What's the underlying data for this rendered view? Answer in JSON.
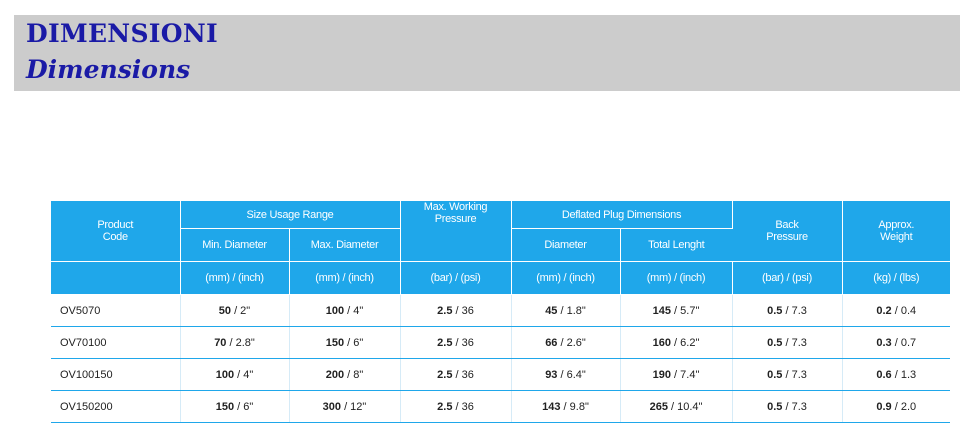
{
  "title": {
    "it": "DIMENSIONI",
    "en": "Dimensions"
  },
  "table": {
    "headers": {
      "product_code": "Product\nCode",
      "size_usage_range": "Size Usage Range",
      "min_diameter": "Min. Diameter",
      "max_diameter": "Max. Diameter",
      "max_working_pressure": "Max. Working\nPressure",
      "deflated_plug_dimensions": "Deflated Plug Dimensions",
      "diameter": "Diameter",
      "total_length": "Total Lenght",
      "back_pressure": "Back\nPressure",
      "approx_weight": "Approx.\nWeight"
    },
    "units": {
      "min_diameter": "(mm) / (inch)",
      "max_diameter": "(mm) / (inch)",
      "pressure": "(bar) / (psi)",
      "diameter": "(mm) / (inch)",
      "total_length": "(mm) / (inch)",
      "back_pressure": "(bar) / (psi)",
      "weight": "(kg) / (lbs)"
    },
    "rows": [
      {
        "code": "OV5070",
        "min_b": "50",
        "min_r": " / 2\"",
        "max_b": "100",
        "max_r": " / 4\"",
        "pres_b": "2.5",
        "pres_r": " / 36",
        "dia_b": "45",
        "dia_r": " / 1.8\"",
        "len_b": "145",
        "len_r": " / 5.7\"",
        "back_b": "0.5",
        "back_r": " / 7.3",
        "wt_b": "0.2",
        "wt_r": " / 0.4"
      },
      {
        "code": "OV70100",
        "min_b": "70",
        "min_r": " / 2.8\"",
        "max_b": "150",
        "max_r": " / 6\"",
        "pres_b": "2.5",
        "pres_r": " / 36",
        "dia_b": "66",
        "dia_r": " / 2.6\"",
        "len_b": "160",
        "len_r": " / 6.2\"",
        "back_b": "0.5",
        "back_r": " / 7.3",
        "wt_b": "0.3",
        "wt_r": " / 0.7"
      },
      {
        "code": "OV100150",
        "min_b": "100",
        "min_r": " / 4\"",
        "max_b": "200",
        "max_r": " / 8\"",
        "pres_b": "2.5",
        "pres_r": " / 36",
        "dia_b": "93",
        "dia_r": " / 6.4\"",
        "len_b": "190",
        "len_r": " / 7.4\"",
        "back_b": "0.5",
        "back_r": " / 7.3",
        "wt_b": "0.6",
        "wt_r": " / 1.3"
      },
      {
        "code": "OV150200",
        "min_b": "150",
        "min_r": " / 6\"",
        "max_b": "300",
        "max_r": " / 12\"",
        "pres_b": "2.5",
        "pres_r": " / 36",
        "dia_b": "143",
        "dia_r": " / 9.8\"",
        "len_b": "265",
        "len_r": " / 10.4\"",
        "back_b": "0.5",
        "back_r": " / 7.3",
        "wt_b": "0.9",
        "wt_r": " / 2.0"
      }
    ]
  },
  "colors": {
    "title": "#1a1aa6",
    "header_band": "#cccccc",
    "table_header": "#1fa7ea"
  }
}
